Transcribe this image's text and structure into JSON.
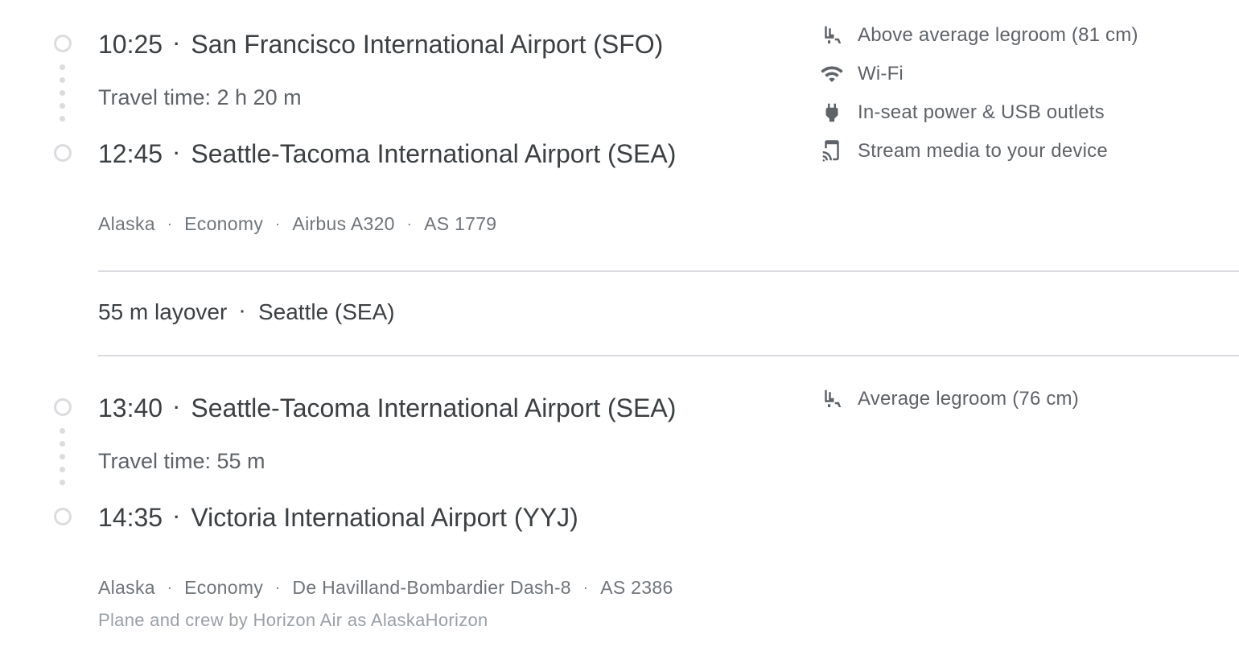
{
  "segments": [
    {
      "departure": {
        "time": "10:25",
        "airport": "San Francisco International Airport (SFO)"
      },
      "travel_time": "Travel time: 2 h 20 m",
      "arrival": {
        "time": "12:45",
        "airport": "Seattle-Tacoma International Airport (SEA)"
      },
      "details": [
        "Alaska",
        "Economy",
        "Airbus A320",
        "AS 1779"
      ],
      "amenities": [
        {
          "icon": "legroom-seat-icon",
          "label": "Above average legroom (81 cm)"
        },
        {
          "icon": "wifi-icon",
          "label": "Wi-Fi"
        },
        {
          "icon": "power-plug-icon",
          "label": "In-seat power & USB outlets"
        },
        {
          "icon": "cast-stream-icon",
          "label": "Stream media to your device"
        }
      ]
    },
    {
      "departure": {
        "time": "13:40",
        "airport": "Seattle-Tacoma International Airport (SEA)"
      },
      "travel_time": "Travel time: 55 m",
      "arrival": {
        "time": "14:35",
        "airport": "Victoria International Airport (YYJ)"
      },
      "details": [
        "Alaska",
        "Economy",
        "De Havilland-Bombardier Dash-8",
        "AS 2386"
      ],
      "operated_by": "Plane and crew by Horizon Air as AlaskaHorizon",
      "amenities": [
        {
          "icon": "legroom-seat-icon",
          "label": "Average legroom (76 cm)"
        }
      ]
    }
  ],
  "layover": {
    "duration": "55 m layover",
    "location": "Seattle (SEA)"
  },
  "separator": "·",
  "colors": {
    "text_primary": "#3c4043",
    "text_secondary": "#5f6368",
    "text_muted": "#70757a",
    "divider": "#dadce0"
  }
}
